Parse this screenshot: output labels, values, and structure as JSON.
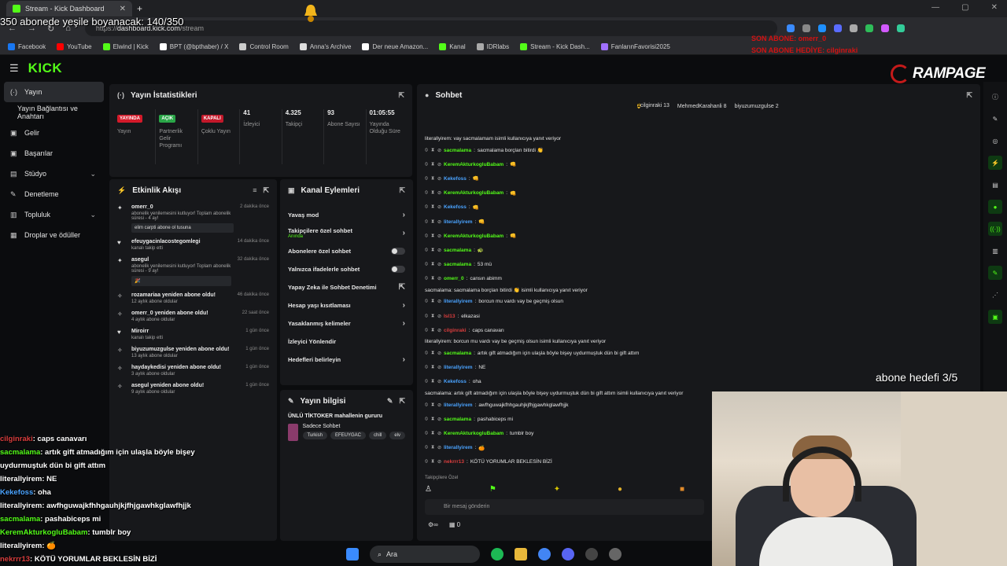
{
  "browser": {
    "tab_title": "Stream - Kick Dashboard",
    "url_prefix": "https://",
    "url_host": "dashboard.kick.com",
    "url_path": "/stream",
    "bookmarks": [
      {
        "label": "Facebook",
        "color": "#1877f2"
      },
      {
        "label": "YouTube",
        "color": "#ff0000"
      },
      {
        "label": "Elwind | Kick",
        "color": "#53fc18"
      },
      {
        "label": "BPT (@bpthaber) / X",
        "color": "#ffffff"
      },
      {
        "label": "Control Room",
        "color": "#cccccc"
      },
      {
        "label": "Anna's Archive",
        "color": "#dddddd"
      },
      {
        "label": "Der neue Amazon...",
        "color": "#ffffff"
      },
      {
        "label": "Kanal",
        "color": "#53fc18"
      },
      {
        "label": "IDRlabs",
        "color": "#aaaaaa"
      },
      {
        "label": "Stream - Kick Dash...",
        "color": "#53fc18"
      },
      {
        "label": "FanlarınFavorisi2025",
        "color": "#a070ff"
      }
    ]
  },
  "overlay": {
    "sub_goal_text": "350 abonede yeşile boyanacak: 140/350",
    "red_line1": "SON ABONE: omerr_0",
    "red_line2": "SON ABONE HEDİYE: cilginraki",
    "goal_text": "abone hedefi 3/5",
    "rampage": "RAMPAGE"
  },
  "kick": {
    "logo": "KICK",
    "sidebar": [
      {
        "label": "Yayın",
        "icon": "broadcast-icon",
        "glyph": "(·)",
        "active": true
      },
      {
        "label": "Yayın Bağlantısı ve Anahtarı",
        "icon": "",
        "glyph": "",
        "sub": true
      },
      {
        "label": "Gelir",
        "icon": "wallet-icon",
        "glyph": "▣"
      },
      {
        "label": "Başarılar",
        "icon": "trophy-icon",
        "glyph": "▣"
      },
      {
        "label": "Stüdyo",
        "icon": "studio-icon",
        "glyph": "▤",
        "chev": true
      },
      {
        "label": "Denetleme",
        "icon": "hammer-icon",
        "glyph": "✎"
      },
      {
        "label": "Topluluk",
        "icon": "community-icon",
        "glyph": "▥",
        "chev": true
      },
      {
        "label": "Droplar ve ödüller",
        "icon": "gift-icon",
        "glyph": "▦"
      }
    ]
  },
  "stats_panel": {
    "title": "Yayın İstatistikleri",
    "items": [
      {
        "badge": "YAYINDA",
        "badge_color": "#d41a2a",
        "label": "Yayın"
      },
      {
        "badge": "AÇIK",
        "badge_color": "#2aa648",
        "label": "Partnerlik Gelir Programı"
      },
      {
        "badge": "KAPALI",
        "badge_color": "#c3182a",
        "label": "Çoklu Yayın"
      },
      {
        "value": "41",
        "label": "İzleyici"
      },
      {
        "value": "4.325",
        "label": "Takipçi"
      },
      {
        "value": "93",
        "label": "Abone Sayısı"
      },
      {
        "value": "01:05:55",
        "label": "Yayında Olduğu Süre"
      }
    ]
  },
  "events_panel": {
    "title": "Etkinlik Akışı",
    "events": [
      {
        "icon": "star-icon",
        "name": "omerr_0",
        "sub": "abonelik yenilemesini kutluyor! Toplam abonelik süresi - 4 ay!",
        "time": "2 dakika önce",
        "msg": "elim carpti abone ol tusuna"
      },
      {
        "icon": "heart-icon",
        "name": "efeuygacinlacostegomlegi",
        "sub": "kanalı takip etti",
        "time": "14 dakika önce"
      },
      {
        "icon": "star-icon",
        "name": "asegul",
        "sub": "abonelik yenilemesini kutluyor! Toplam abonelik süresi - 9 ay!",
        "time": "32 dakika önce",
        "msg": "🎉"
      },
      {
        "icon": "sparkle-icon",
        "name": "rozamariaa yeniden abone oldu!",
        "sub": "12 aylık abone oldular",
        "time": "46 dakika önce"
      },
      {
        "icon": "sparkle-icon",
        "name": "omerr_0 yeniden abone oldu!",
        "sub": "4 aylık abone oldular",
        "time": "22 saat önce"
      },
      {
        "icon": "heart-icon",
        "name": "Miroirr",
        "sub": "kanalı takip etti",
        "time": "1 gün önce"
      },
      {
        "icon": "sparkle-icon",
        "name": "biyuzumuzgulse yeniden abone oldu!",
        "sub": "13 aylık abone oldular",
        "time": "1 gün önce"
      },
      {
        "icon": "sparkle-icon",
        "name": "haydaykedisi yeniden abone oldu!",
        "sub": "3 aylık abone oldular",
        "time": "1 gün önce"
      },
      {
        "icon": "sparkle-icon",
        "name": "asegul yeniden abone oldu!",
        "sub": "9 aylık abone oldular",
        "time": "1 gün önce"
      }
    ]
  },
  "actions_panel": {
    "title": "Kanal Eylemleri",
    "items": [
      {
        "label": "Yavaş mod",
        "kind": "chevron"
      },
      {
        "label": "Takipçilere özel sohbet",
        "sub": "Anında",
        "kind": "chevron"
      },
      {
        "label": "Abonelere özel sohbet",
        "kind": "toggle"
      },
      {
        "label": "Yalnızca ifadelerle sohbet",
        "kind": "toggle"
      },
      {
        "label": "Yapay Zeka ile Sohbet Denetimi",
        "kind": "external"
      },
      {
        "label": "Hesap yaşı kısıtlaması",
        "kind": "chevron"
      },
      {
        "label": "Yasaklanmış kelimeler",
        "kind": "chevron"
      },
      {
        "label": "İzleyici Yönlendir",
        "kind": "none"
      },
      {
        "label": "Hedefleri belirleyin",
        "kind": "chevron"
      }
    ]
  },
  "info_panel": {
    "title": "Yayın bilgisi",
    "stream_title": "ÜNLÜ TİKTOKER mahallenin gururu",
    "category": "Sadece Sohbet",
    "tags": [
      "Turkish",
      "EFEUYGAC",
      "chill",
      "elv"
    ]
  },
  "chat": {
    "title": "Sohbet",
    "pinned": [
      {
        "name": "cilginraki",
        "count": "13"
      },
      {
        "name": "MehmedKarahanli",
        "count": "8"
      },
      {
        "name": "biyuzumuzgulse",
        "count": "2"
      }
    ],
    "lines": [
      {
        "reply": "literallyirem: vay sacmalamam isimli kullanıcıya yanıt veriyor"
      },
      {
        "user": "sacmalama",
        "color": "#53fc18",
        "text": "sacmalama borçları bitirdi 👏"
      },
      {
        "user": "KeremAkturkogluBabam",
        "color": "#53fc18",
        "text": "👊"
      },
      {
        "user": "Kekefoss",
        "color": "#4aa3ff",
        "text": "👊"
      },
      {
        "user": "KeremAkturkogluBabam",
        "color": "#53fc18",
        "text": "👊"
      },
      {
        "user": "Kekefoss",
        "color": "#4aa3ff",
        "text": "👊"
      },
      {
        "user": "literallyirem",
        "color": "#4aa3ff",
        "text": "👊"
      },
      {
        "user": "KeremAkturkogluBabam",
        "color": "#53fc18",
        "text": "👊"
      },
      {
        "user": "sacmalama",
        "color": "#53fc18",
        "text": "🐢"
      },
      {
        "user": "sacmalama",
        "color": "#53fc18",
        "text": "53 mü"
      },
      {
        "user": "omerr_0",
        "color": "#53fc18",
        "text": "cansın abimm"
      },
      {
        "reply": "sacmalama: sacmalama borçları bitirdi 👏 isimli kullanıcıya yanıt veriyor"
      },
      {
        "user": "literallyirem",
        "color": "#4aa3ff",
        "text": "borcun mu vardı vay be geçmiş olsun"
      },
      {
        "user": "IsI13",
        "color": "#d93d3d",
        "text": "elkazasi"
      },
      {
        "user": "cilginraki",
        "color": "#d93d3d",
        "text": "caps canavarı"
      },
      {
        "reply": "literallyirem: borcun mu vardı vay be geçmiş olsun isimli kullanıcıya yanıt veriyor"
      },
      {
        "user": "sacmalama",
        "color": "#53fc18",
        "text": "artık gift atmadığım için ulaşla böyle bişey uydurmuştuk dün bi gift attım"
      },
      {
        "user": "literallyirem",
        "color": "#4aa3ff",
        "text": "NE"
      },
      {
        "user": "Kekefoss",
        "color": "#4aa3ff",
        "text": "oha"
      },
      {
        "reply": "sacmalama: artık gift atmadığım için ulaşla böyle bişey uydurmuştuk dün bi gift attım isimli kullanıcıya yanıt veriyor"
      },
      {
        "user": "literallyirem",
        "color": "#4aa3ff",
        "text": "awfhguwajkfhhgauhjkjfhjgawhkglawfhjjk"
      },
      {
        "user": "sacmalama",
        "color": "#53fc18",
        "text": "pashabiceps mi"
      },
      {
        "user": "KeremAkturkogluBabam",
        "color": "#53fc18",
        "text": "tumblr boy"
      },
      {
        "user": "literallyirem",
        "color": "#4aa3ff",
        "text": "🍊"
      },
      {
        "user": "nekrrr13",
        "color": "#d93d3d",
        "text": "KÖTÜ YORUMLAR BEKLESİN BİZİ"
      }
    ],
    "followers_only": "Takipçilere Özel",
    "input_placeholder": "Bir mesaj gönderin",
    "footer_count": "0"
  },
  "overlay_chat": [
    {
      "user": "cilginraki",
      "color": "#d93d3d",
      "text": ": caps canavarı"
    },
    {
      "user": "sacmalama",
      "color": "#53fc18",
      "text": ": artık gift atmadığım için ulaşla böyle bişey uydurmuştuk dün bi gift attım"
    },
    {
      "user": "literallyirem",
      "color": "#ffffff",
      "text": ": NE"
    },
    {
      "user": "Kekefoss",
      "color": "#4aa3ff",
      "text": ": oha"
    },
    {
      "user": "literallyirem",
      "color": "#ffffff",
      "text": ": awfhguwajkfhhgauhjkjfhjgawhkglawfhjjk"
    },
    {
      "user": "sacmalama",
      "color": "#53fc18",
      "text": ": pashabiceps mi"
    },
    {
      "user": "KeremAkturkogluBabam",
      "color": "#53fc18",
      "text": ": tumblr boy"
    },
    {
      "user": "literallyirem",
      "color": "#ffffff",
      "text": ": 🍊"
    },
    {
      "user": "nekrrr13",
      "color": "#d93d3d",
      "text": ": KÖTÜ YORUMLAR BEKLESİN BİZİ"
    }
  ],
  "taskbar": {
    "search_label": "Ara"
  }
}
